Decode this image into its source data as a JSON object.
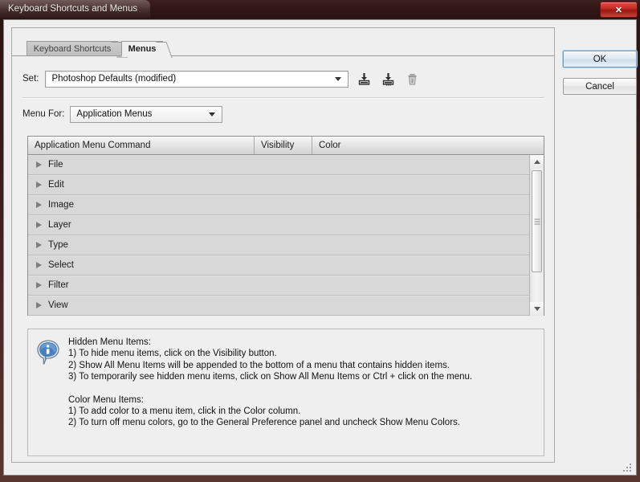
{
  "window": {
    "title": "Keyboard Shortcuts and Menus",
    "close_label": "✕",
    "close_icon": "close-icon"
  },
  "tabs": [
    {
      "label": "Keyboard Shortcuts",
      "active": false
    },
    {
      "label": "Menus",
      "active": true
    }
  ],
  "set_row": {
    "label": "Set:",
    "value": "Photoshop Defaults (modified)",
    "icons": [
      {
        "name": "save-set-icon",
        "title": "Save Set"
      },
      {
        "name": "save-set-as-icon",
        "title": "Save Set As"
      },
      {
        "name": "delete-set-icon",
        "title": "Delete Set"
      }
    ]
  },
  "menu_for": {
    "label": "Menu For:",
    "value": "Application Menus"
  },
  "table": {
    "columns": [
      "Application Menu Command",
      "Visibility",
      "Color"
    ],
    "rows": [
      {
        "label": "File"
      },
      {
        "label": "Edit"
      },
      {
        "label": "Image"
      },
      {
        "label": "Layer"
      },
      {
        "label": "Type"
      },
      {
        "label": "Select"
      },
      {
        "label": "Filter"
      },
      {
        "label": "View"
      }
    ]
  },
  "info": {
    "icon": "info-icon",
    "hidden_heading": "Hidden Menu Items:",
    "hidden_lines": [
      "1) To hide menu items, click on the Visibility button.",
      "2) Show All Menu Items will be appended to the bottom of a menu that contains hidden items.",
      "3) To temporarily see hidden menu items, click on Show All Menu Items or Ctrl + click on the menu."
    ],
    "color_heading": "Color Menu Items:",
    "color_lines": [
      "1) To add color to a menu item, click in the Color column.",
      "2) To turn off menu colors, go to the General Preference panel and uncheck Show Menu Colors."
    ]
  },
  "buttons": {
    "ok": "OK",
    "cancel": "Cancel"
  },
  "colors": {
    "titlebar": "#2a1213",
    "dialog_bg": "#efefef",
    "list_row": "#d8d8d8",
    "accent_blue": "#6d9fc4",
    "close_red": "#c22c24",
    "info_blue": "#3b6ea8"
  }
}
